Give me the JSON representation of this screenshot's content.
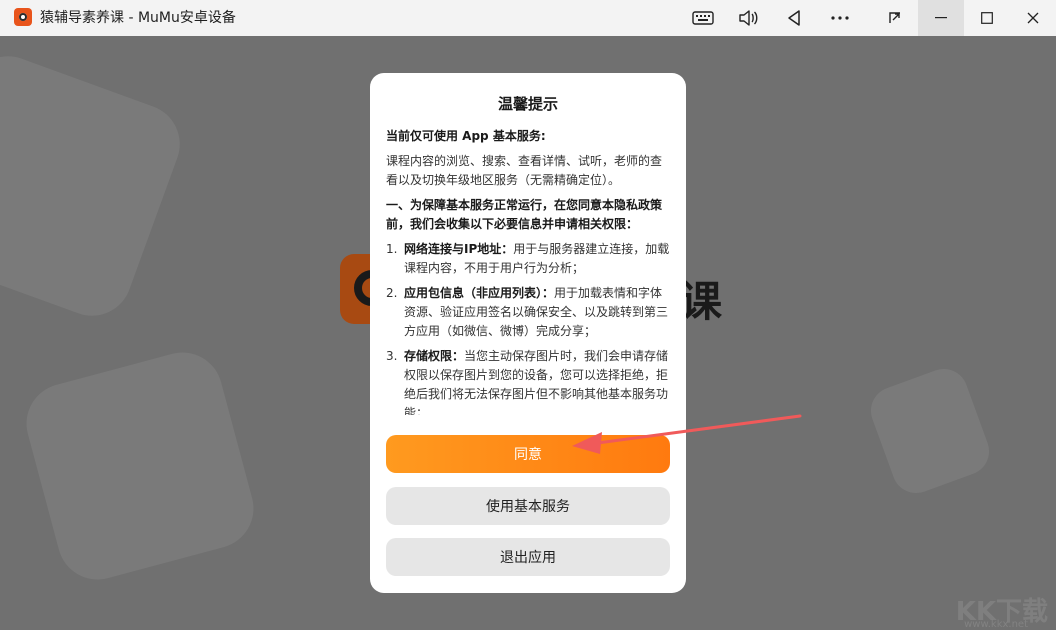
{
  "window": {
    "title": "猿辅导素养课 - MuMu安卓设备"
  },
  "icons": {
    "app": "app-logo-icon",
    "keyboard": "keyboard-icon",
    "volume": "volume-icon",
    "back": "back-triangle-icon",
    "more": "more-dots-icon",
    "screenshot": "screenshot-icon",
    "minimize": "minimize-icon",
    "maximize": "maximize-icon",
    "close": "close-icon"
  },
  "splash": {
    "text": "课"
  },
  "dialog": {
    "title": "温馨提示",
    "intro_heading": "当前仅可使用 App 基本服务:",
    "intro_text": "课程内容的浏览、搜索、查看详情、试听，老师的查看以及切换年级地区服务（无需精确定位）。",
    "section_heading": "一、为保障基本服务正常运行，在您同意本隐私政策前，我们会收集以下必要信息并申请相关权限：",
    "items": [
      {
        "num": "1.",
        "title": "网络连接与IP地址：",
        "text": "用于与服务器建立连接，加载课程内容，不用于用户行为分析；"
      },
      {
        "num": "2.",
        "title": "应用包信息（非应用列表）：",
        "text": "用于加载表情和字体资源、验证应用签名以确保安全、以及跳转到第三方应用（如微信、微博）完成分享；"
      },
      {
        "num": "3.",
        "title": "存储权限：",
        "text": "当您主动保存图片时，我们会申请存储权限以保存图片到您的设备，您可以选择拒绝，拒绝后我们将无法保存图片但不影响其他基本服务功能；"
      }
    ],
    "agree_label": "同意",
    "basic_label": "使用基本服务",
    "exit_label": "退出应用"
  },
  "watermark": {
    "text": "KK下载",
    "url": "www.kkx.net"
  },
  "colors": {
    "accent": "#ff8a16",
    "arrow": "#f05a5a"
  }
}
